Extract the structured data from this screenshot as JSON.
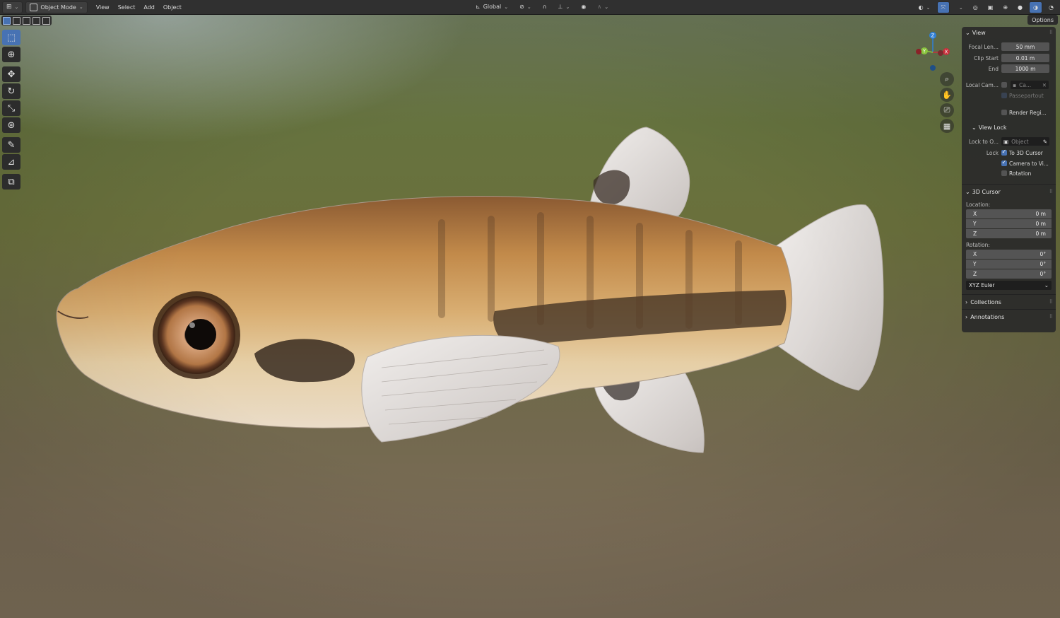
{
  "header": {
    "editor_type_icon": "viewport-3d-icon",
    "mode": "Object Mode",
    "menus": [
      "View",
      "Select",
      "Add",
      "Object"
    ],
    "transform_orientation": "Global",
    "pivot_icon": "pivot-icon",
    "snap_icon": "magnet-icon",
    "proportional_icon": "proportional-edit-icon"
  },
  "options_label": "Options",
  "toolbar": {
    "tools": [
      "select-box",
      "cursor",
      "move",
      "rotate",
      "scale",
      "transform",
      "annotate",
      "measure",
      "add-cube"
    ],
    "active": "select-box"
  },
  "gizmo": {
    "x": "X",
    "y": "Y",
    "z": "Z"
  },
  "sidebar": {
    "view": {
      "title": "View",
      "focal_length_label": "Focal Len...",
      "focal_length": "50 mm",
      "clip_start_label": "Clip Start",
      "clip_start": "0.01 m",
      "clip_end_label": "End",
      "clip_end": "1000 m",
      "local_camera_label": "Local Cam...",
      "local_camera_value": "Ca...",
      "passepartout": "Passepartout",
      "render_region": "Render Regi..."
    },
    "view_lock": {
      "title": "View Lock",
      "lock_to_object_label": "Lock to O...",
      "lock_to_object_placeholder": "Object",
      "lock_label": "Lock",
      "to_3d_cursor": "To 3D Cursor",
      "camera_to_view": "Camera to Vi...",
      "rotation": "Rotation"
    },
    "cursor": {
      "title": "3D Cursor",
      "location_label": "Location:",
      "location": [
        {
          "axis": "X",
          "value": "0 m"
        },
        {
          "axis": "Y",
          "value": "0 m"
        },
        {
          "axis": "Z",
          "value": "0 m"
        }
      ],
      "rotation_label": "Rotation:",
      "rotation": [
        {
          "axis": "X",
          "value": "0°"
        },
        {
          "axis": "Y",
          "value": "0°"
        },
        {
          "axis": "Z",
          "value": "0°"
        }
      ],
      "rotation_mode": "XYZ Euler"
    },
    "collections": "Collections",
    "annotations": "Annotations"
  },
  "colors": {
    "accent": "#4772b3",
    "gizmo_x": "#c8303c",
    "gizmo_y": "#8ac53e",
    "gizmo_z": "#2f7fd8"
  }
}
